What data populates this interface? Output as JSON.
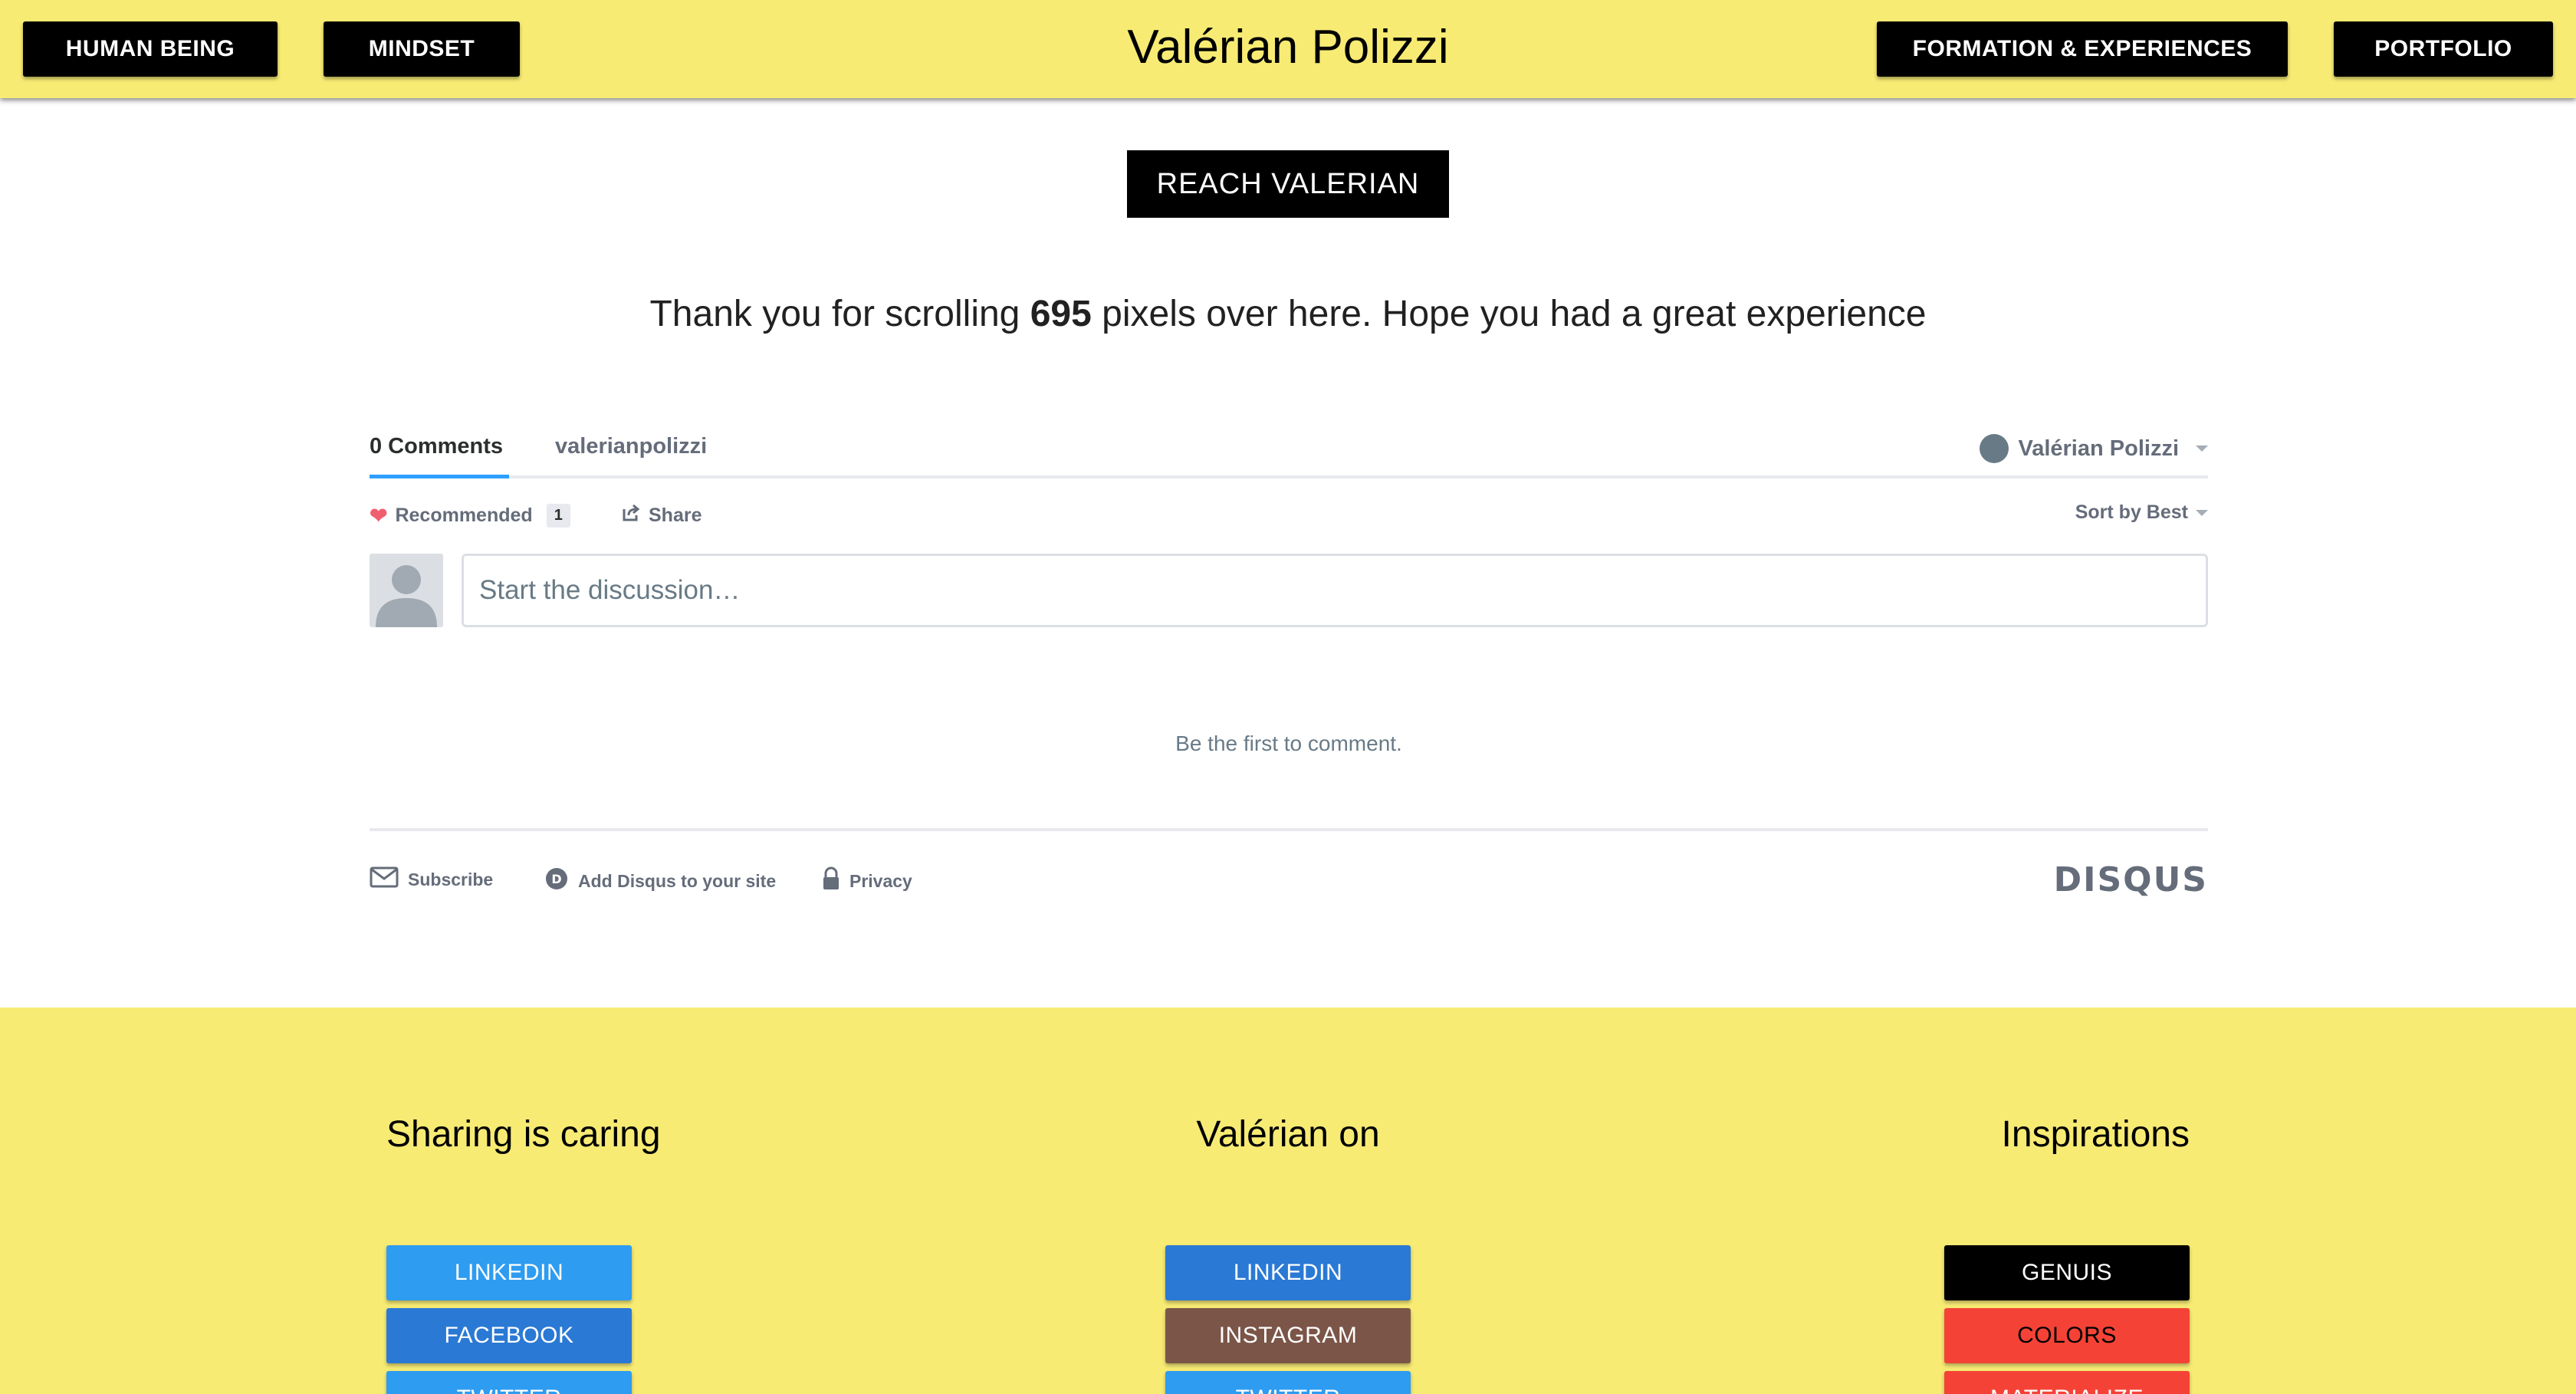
{
  "header": {
    "title": "Valérian Polizzi",
    "nav_left": [
      "HUMAN BEING",
      "MINDSET"
    ],
    "nav_right": [
      "FORMATION & EXPERIENCES",
      "PORTFOLIO"
    ]
  },
  "reach": {
    "button_label": "REACH VALERIAN"
  },
  "scroll_message": {
    "prefix": "Thank you for scrolling",
    "pixels": "695",
    "suffix": "pixels over here. Hope you had a great experience"
  },
  "disqus": {
    "tab_comments": "0 Comments",
    "tab_forum": "valerianpolizzi",
    "user_name": "Valérian Polizzi",
    "recommended_label": "Recommended",
    "recommended_count": "1",
    "share_label": "Share",
    "sort_label": "Sort by Best",
    "input_placeholder": "Start the discussion…",
    "empty_message": "Be the first to comment.",
    "footer": {
      "subscribe": "Subscribe",
      "add_disqus": "Add Disqus to your site",
      "privacy": "Privacy",
      "brand": "DISQUS"
    }
  },
  "footer": {
    "col1": {
      "heading": "Sharing is caring",
      "buttons": [
        "LINKEDIN",
        "FACEBOOK",
        "TWITTER"
      ]
    },
    "col2": {
      "heading": "Valérian on",
      "buttons": [
        "LINKEDIN",
        "INSTAGRAM",
        "TWITTER"
      ]
    },
    "col3": {
      "heading": "Inspirations",
      "buttons": [
        "GENUIS",
        "COLORS",
        "MATERIALIZE"
      ]
    }
  },
  "colors": {
    "yellow": "#f7eb74",
    "black": "#000000",
    "light_blue": "#2e9cf0",
    "blue": "#2a79d4",
    "brown": "#7b5548",
    "red": "#f44336"
  }
}
